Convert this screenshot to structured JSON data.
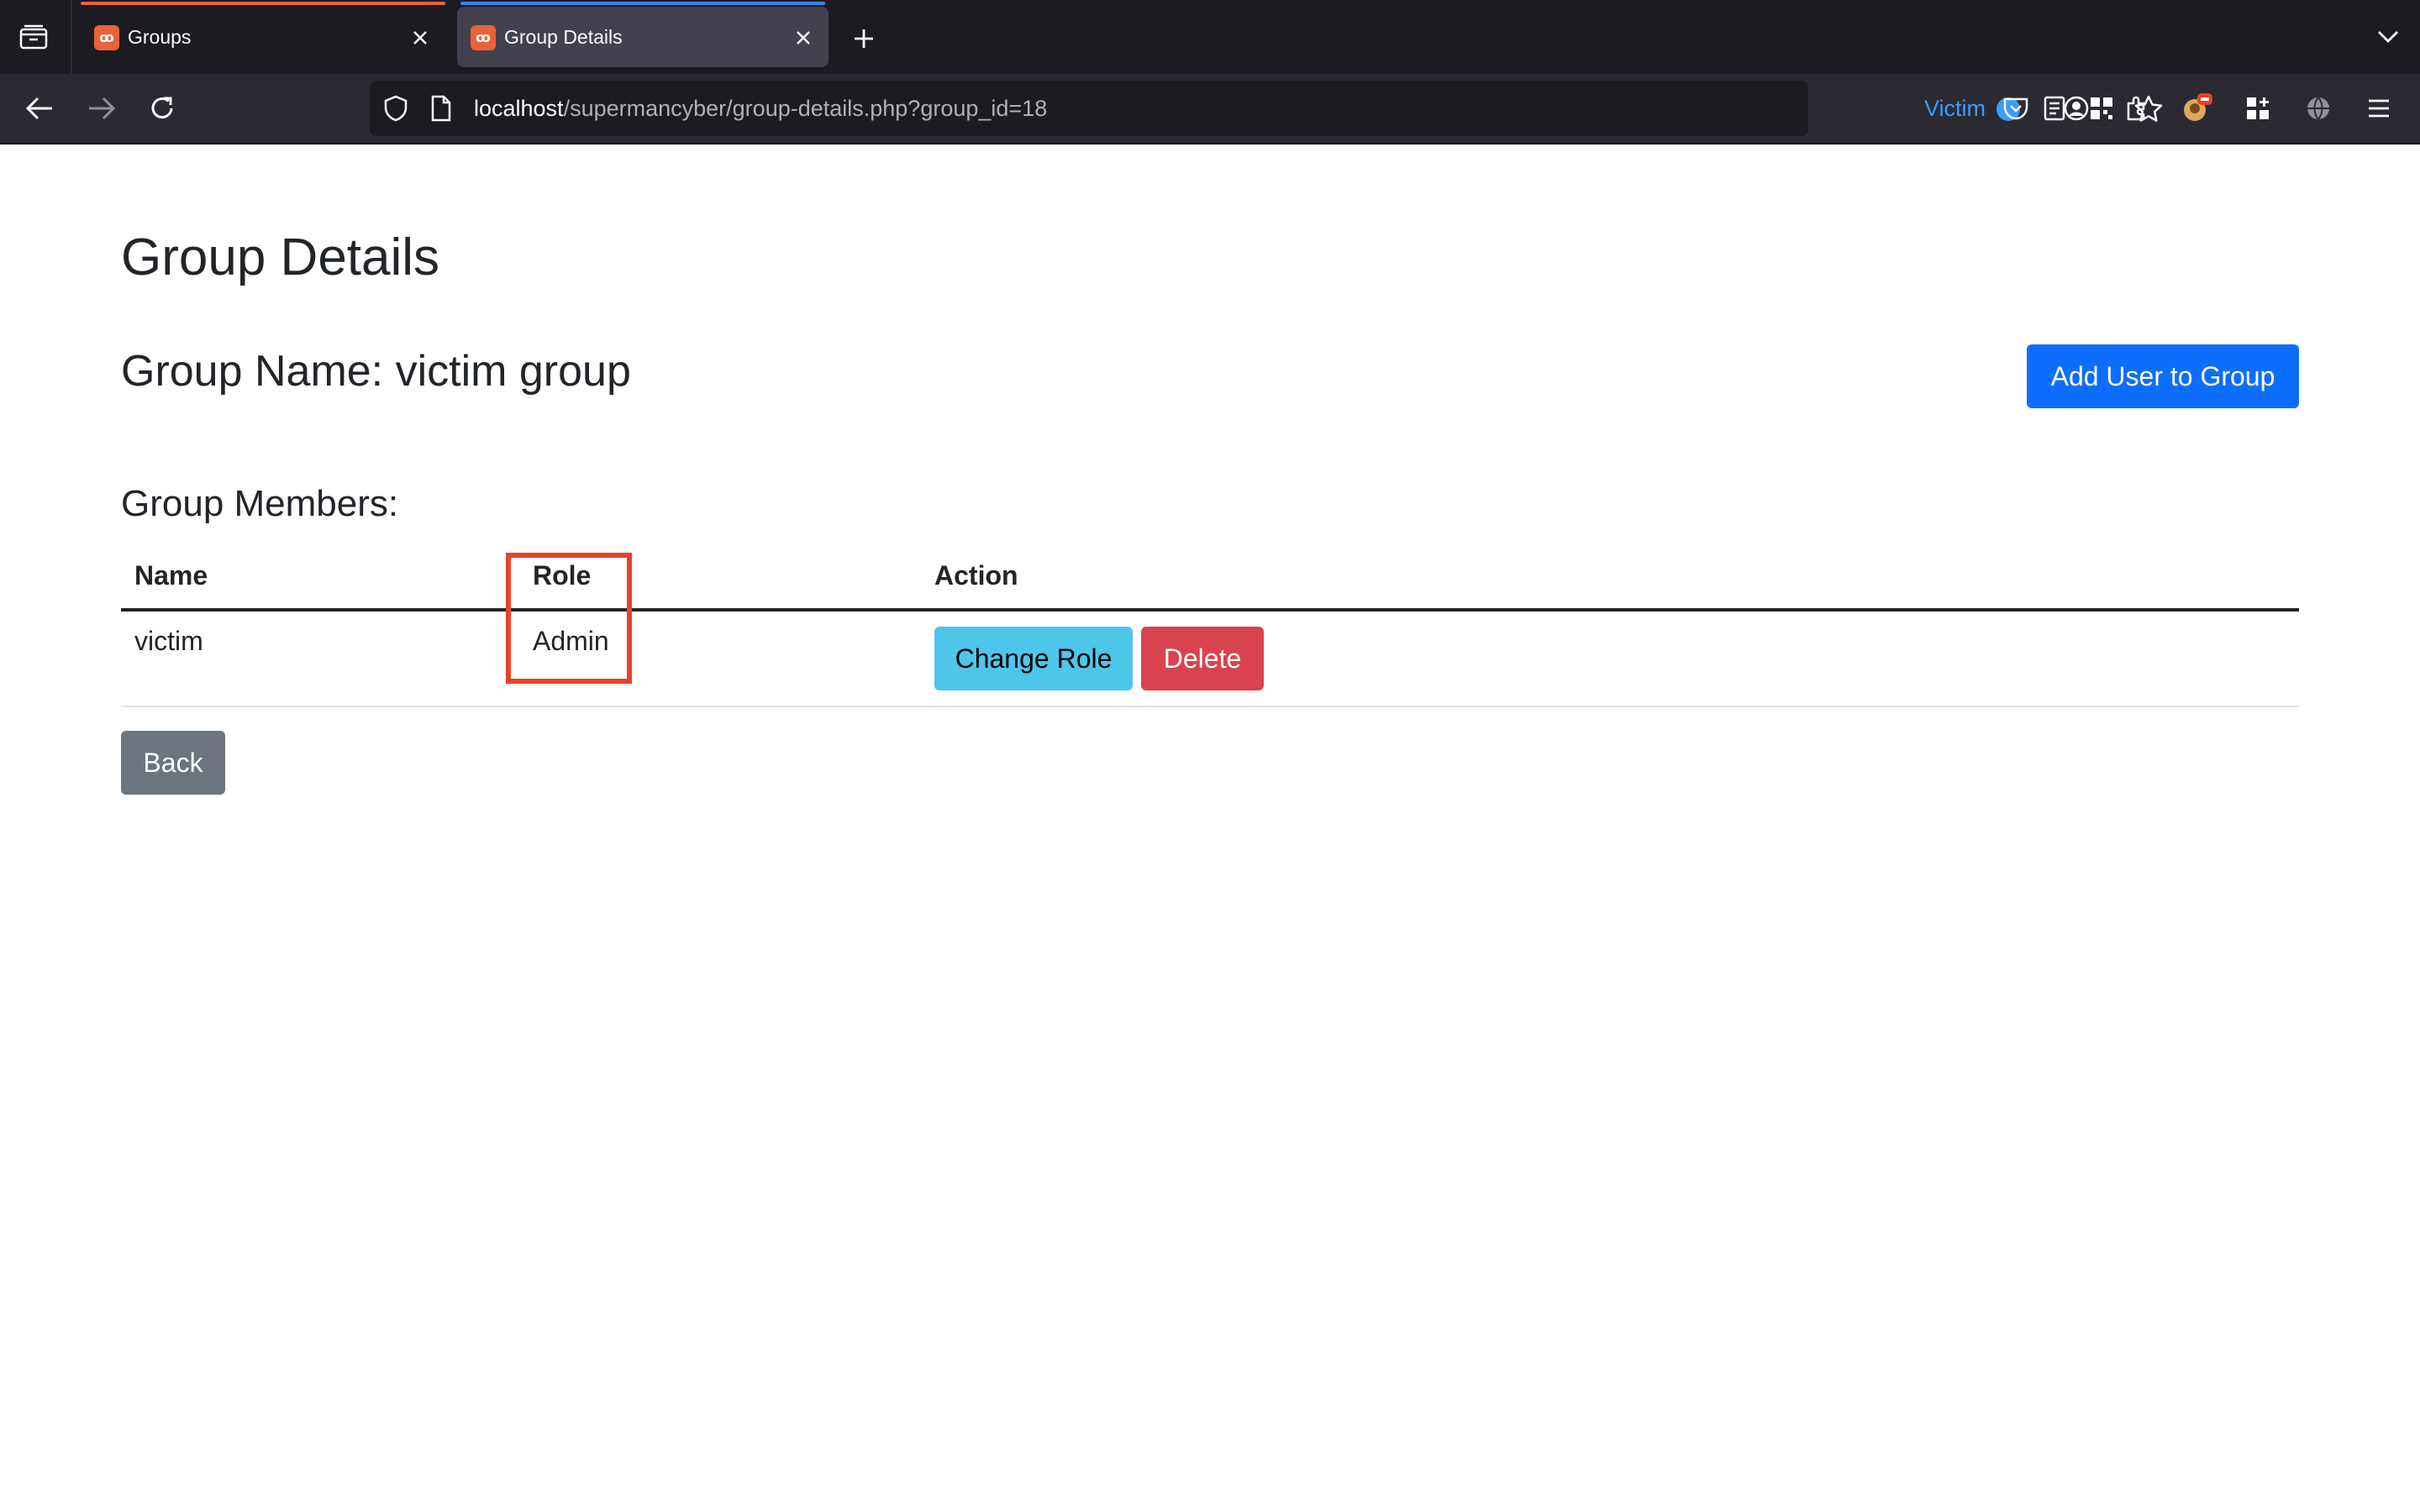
{
  "browser": {
    "tabs": [
      {
        "title": "Groups",
        "active": false
      },
      {
        "title": "Group Details",
        "active": true
      }
    ],
    "url_host": "localhost",
    "url_path": "/supermancyber/group-details.php?group_id=18",
    "container_label": "Victim",
    "colors": {
      "container": "#3b9cff",
      "tab_accent": "#e8633a",
      "active_tab_line": "#3b82f6"
    }
  },
  "page": {
    "title": "Group Details",
    "group_name": "Group Name: victim group",
    "add_user_label": "Add User to Group",
    "members_title": "Group Members:",
    "table": {
      "headers": [
        "Name",
        "Role",
        "Action"
      ],
      "rows": [
        {
          "name": "victim",
          "role": "Admin",
          "actions": [
            "Change Role",
            "Delete"
          ]
        }
      ]
    },
    "back_label": "Back",
    "colors": {
      "primary": "#0d6efd",
      "info": "#4ec6ea",
      "danger": "#d9434f",
      "secondary": "#6c757d",
      "highlight": "#e8422a"
    }
  }
}
